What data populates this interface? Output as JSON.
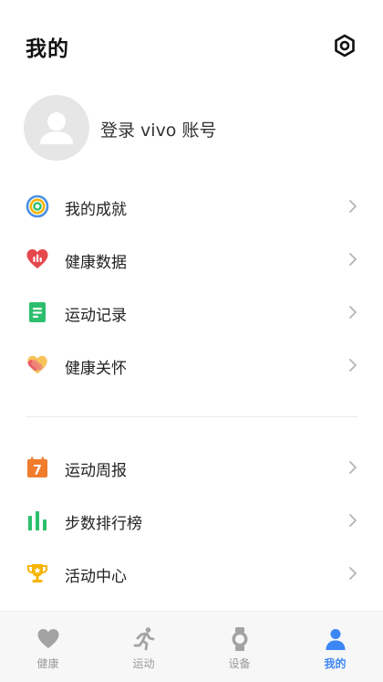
{
  "header": {
    "title": "我的",
    "settings_icon": "settings-icon"
  },
  "profile": {
    "login_label": "登录 vivo 账号",
    "avatar_icon": "default-avatar-icon"
  },
  "menu_group_1": [
    {
      "label": "我的成就",
      "icon": "achievement-icon",
      "color": "#4a90e2"
    },
    {
      "label": "健康数据",
      "icon": "heart-chart-icon",
      "color": "#e5484d"
    },
    {
      "label": "运动记录",
      "icon": "document-icon",
      "color": "#2dbf6e"
    },
    {
      "label": "健康关怀",
      "icon": "care-heart-icon",
      "color": "#f08a7a"
    }
  ],
  "menu_group_2": [
    {
      "label": "运动周报",
      "icon": "calendar-icon",
      "color": "#f07c2c",
      "badge_text": "7"
    },
    {
      "label": "步数排行榜",
      "icon": "bar-chart-icon",
      "color": "#2dbf6e"
    },
    {
      "label": "活动中心",
      "icon": "trophy-icon",
      "color": "#f5b400"
    }
  ],
  "tabbar": {
    "tabs": [
      {
        "label": "健康",
        "icon": "heart-icon",
        "active": false
      },
      {
        "label": "运动",
        "icon": "running-icon",
        "active": false
      },
      {
        "label": "设备",
        "icon": "watch-icon",
        "active": false
      },
      {
        "label": "我的",
        "icon": "person-icon",
        "active": true
      }
    ],
    "active_color": "#3d86f5",
    "inactive_color": "#9a9a9a"
  }
}
